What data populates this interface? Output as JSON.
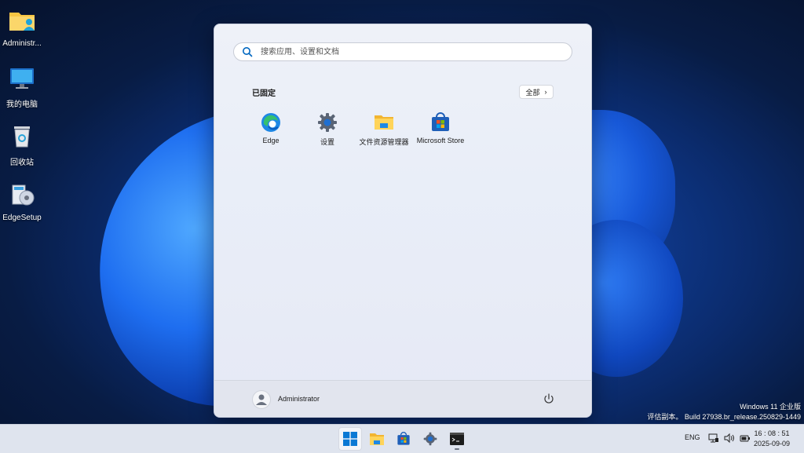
{
  "desktop": {
    "icons": [
      {
        "label": "Administr...",
        "icon": "user-folder-icon"
      },
      {
        "label": "我的电脑",
        "icon": "monitor-icon"
      },
      {
        "label": "回收站",
        "icon": "recycle-bin-icon"
      },
      {
        "label": "EdgeSetup",
        "icon": "installer-icon"
      }
    ]
  },
  "start_menu": {
    "search_placeholder": "搜索应用、设置和文档",
    "pinned_title": "已固定",
    "all_button": "全部",
    "all_chevron": "›",
    "pinned_apps": [
      {
        "label": "Edge",
        "icon": "edge-icon"
      },
      {
        "label": "设置",
        "icon": "settings-gear-icon"
      },
      {
        "label": "文件资源管理器",
        "icon": "file-explorer-icon"
      },
      {
        "label": "Microsoft Store",
        "icon": "store-icon"
      }
    ],
    "user_name": "Administrator"
  },
  "watermark": {
    "line1": "Windows 11 企业版",
    "line2": "评估副本。 Build 27938.br_release.250829-1449"
  },
  "taskbar": {
    "apps": [
      "start-icon",
      "file-explorer-icon",
      "store-icon",
      "settings-gear-icon",
      "terminal-icon"
    ],
    "language": "ENG",
    "time": "16 : 08 : 51",
    "date": "2025-09-09"
  },
  "colors": {
    "accent": "#0067c0",
    "start_bg": "#eef1f8",
    "taskbar_bg": "#dfe4ee"
  }
}
